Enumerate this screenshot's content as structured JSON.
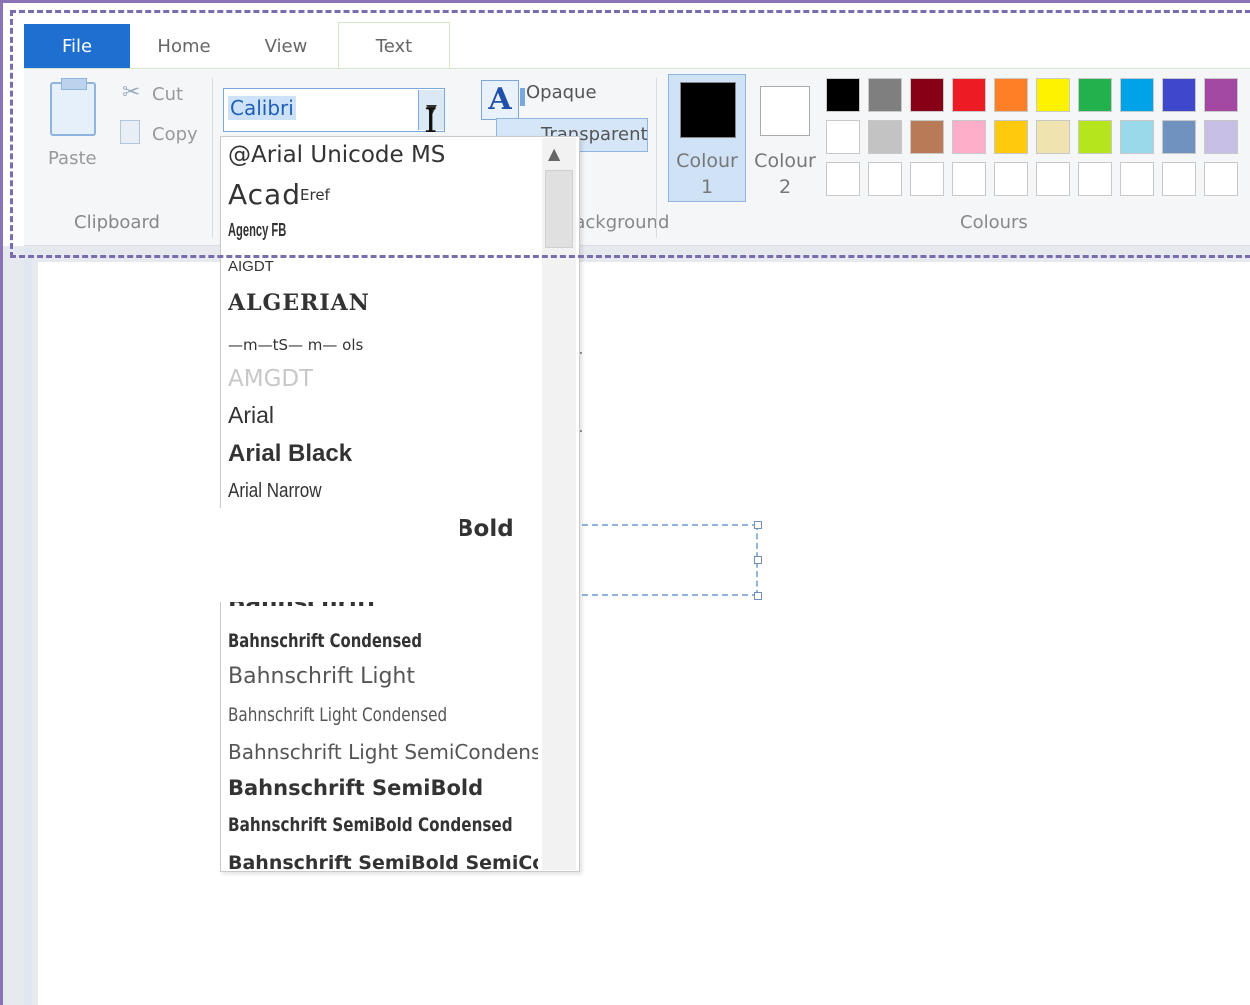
{
  "tabs": {
    "file": "File",
    "home": "Home",
    "view": "View",
    "text": "Text"
  },
  "clipboard": {
    "paste": "Paste",
    "cut": "Cut",
    "copy": "Copy",
    "group_label": "Clipboard"
  },
  "font": {
    "value": "Calibri"
  },
  "background": {
    "opaque": "Opaque",
    "transparent": "Transparent",
    "group_label": "Background"
  },
  "colours": {
    "colour1_label": "Colour",
    "colour1_num": "1",
    "colour2_label": "Colour",
    "colour2_num": "2",
    "group_label": "Colours",
    "colour1_value": "#000000",
    "colour2_value": "#ffffff",
    "row1": [
      "#000000",
      "#7f7f7f",
      "#880015",
      "#ed1c24",
      "#ff7f27",
      "#fff200",
      "#22b14c",
      "#00a2e8",
      "#3f48cc",
      "#a349a4"
    ],
    "row2": [
      "#ffffff",
      "#c3c3c3",
      "#b97a57",
      "#ffaec9",
      "#ffc90e",
      "#efe4b0",
      "#b5e61d",
      "#99d9ea",
      "#7092be",
      "#c8bfe7"
    ]
  },
  "font_list": [
    "@Arial Unicode MS",
    "Acad",
    "Agency FB",
    "AIGDT",
    "ALGERIAN",
    "—m—tS— m— ols",
    "AMGDT",
    "Arial",
    "Arial Black",
    "Arial Narrow",
    "Bold",
    "Bahnschrift",
    "Bahnschrift Condensed",
    "Bahnschrift Light",
    "Bahnschrift Light Condensed",
    "Bahnschrift Light SemiCondens",
    "Bahnschrift SemiBold",
    "Bahnschrift SemiBold Condensed",
    "Bahnschrift SemiBold SemiCond"
  ],
  "font_list_extra": {
    "acad_suffix": "Eref"
  }
}
